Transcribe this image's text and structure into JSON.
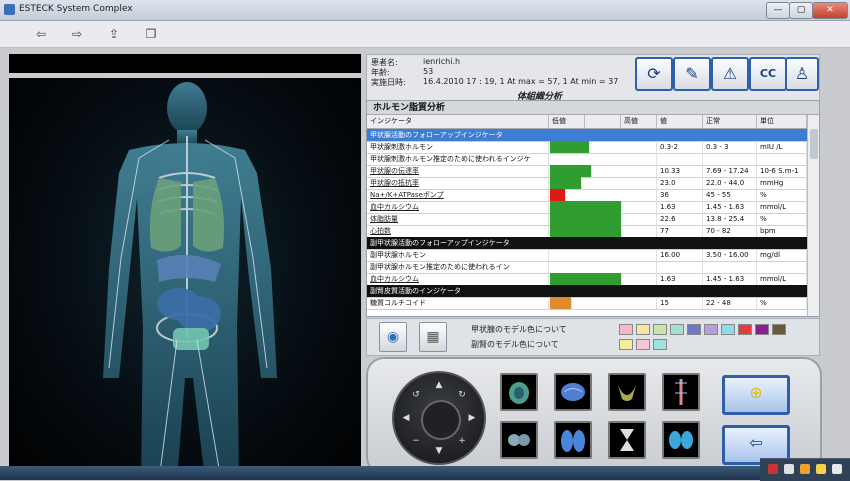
{
  "window": {
    "title": "ESTECK System Complex",
    "controls": {
      "minimize": "—",
      "maximize": "▢",
      "close": "✕"
    }
  },
  "toolbar": {
    "back": "⇦",
    "forward": "⇨",
    "export": "⇪",
    "copy": "❐"
  },
  "patient": {
    "name_label": "患者名:",
    "name_value": "ienrichi.h",
    "age_label": "年齢:",
    "age_value": "53",
    "date_label": "実施日時:",
    "date_value": "16.4.2010 17 : 19, 1 At max = 57, 1 At min = 37"
  },
  "panel_caption": "体組織分析",
  "section_title": "ホルモン脂質分析",
  "columns": [
    "インジケータ",
    "低値",
    "",
    "高値",
    "値",
    "正常",
    "単位"
  ],
  "rows": [
    {
      "type": "group",
      "selected": true,
      "name": "甲状腺活動のフォローアップインジケータ"
    },
    {
      "type": "item",
      "name": "甲状腺刺激ホルモン",
      "value": "0.3-2",
      "normal": "0.3 - 3",
      "unit": "mIU /L",
      "bar_level": 0.55,
      "bar_color": "#2f9d2f"
    },
    {
      "type": "item",
      "name": "甲状腺刺激ホルモン推定のために使われるインジケ",
      "value": "",
      "normal": "",
      "unit": "",
      "bar_level": 0,
      "bar_color": "#2f9d2f"
    },
    {
      "type": "sub",
      "name": "甲状腺の伝達率",
      "value": "10.33",
      "normal": "7.69 - 17.24",
      "unit": "10-6 S.m-1",
      "bar_level": 0.58,
      "bar_color": "#2f9d2f"
    },
    {
      "type": "sub",
      "name": "甲状腺の抵抗率",
      "value": "23.0",
      "normal": "22.0 - 44.0",
      "unit": "mmHg",
      "bar_level": 0.45,
      "bar_color": "#2f9d2f"
    },
    {
      "type": "sub",
      "name": "Na+/K+ATPaseポンプ",
      "value": "36",
      "normal": "45 - 55",
      "unit": "%",
      "bar_level": 0.22,
      "bar_color": "#e01818"
    },
    {
      "type": "sub",
      "name": "血中カルシウム",
      "value": "1.63",
      "normal": "1.45 - 1.63",
      "unit": "mmol/L",
      "bar_level": 1.0,
      "bar_color": "#2f9d2f"
    },
    {
      "type": "sub",
      "name": "体脂肪量",
      "value": "22.6",
      "normal": "13.8 - 25.4",
      "unit": "%",
      "bar_level": 1.0,
      "bar_color": "#2f9d2f"
    },
    {
      "type": "sub",
      "name": "心拍数",
      "value": "77",
      "normal": "70 - 82",
      "unit": "bpm",
      "bar_level": 1.0,
      "bar_color": "#2f9d2f"
    },
    {
      "type": "group",
      "selected": false,
      "name": "副甲状腺活動のフォローアップインジケータ"
    },
    {
      "type": "item",
      "name": "副甲状腺ホルモン",
      "value": "16.00",
      "normal": "3.50 - 16.00",
      "unit": "mg/dl",
      "bar_level": 0,
      "bar_color": "#2f9d2f"
    },
    {
      "type": "item",
      "name": "副甲状腺ホルモン推定のために使われるイン",
      "value": "",
      "normal": "",
      "unit": "",
      "bar_level": 0,
      "bar_color": "#2f9d2f"
    },
    {
      "type": "sub",
      "name": "血中カルシウム",
      "value": "1.63",
      "normal": "1.45 - 1.63",
      "unit": "mmol/L",
      "bar_level": 1.0,
      "bar_color": "#2f9d2f"
    },
    {
      "type": "group",
      "selected": false,
      "name": "副腎皮質活動のインジケータ"
    },
    {
      "type": "item",
      "name": "糖質コルチコイド",
      "value": "15",
      "normal": "22 - 48",
      "unit": "%",
      "bar_level": 0.3,
      "bar_color": "#e08a30"
    }
  ],
  "legend": {
    "line1": "甲状腺のモデル色について",
    "line2": "副腎のモデル色について",
    "colors1": [
      "#f6b6c8",
      "#f4e8a0",
      "#c9e4a8",
      "#a8dfd0",
      "#6b79c6",
      "#b79de0",
      "#8fd8e8",
      "#e03c3c",
      "#8c1d8c",
      "#6b5a3a"
    ],
    "colors2": [
      "#f4ec9a",
      "#f4c6d6",
      "#9fe3e0"
    ]
  },
  "icons": {
    "top": [
      "refresh-icon",
      "tool-icon",
      "warning-icon",
      "cc-icon",
      "tube-icon"
    ],
    "top_glyphs": [
      "⟳",
      "✎",
      "⚠",
      "CC",
      "♙"
    ],
    "legend_btn1": "◉",
    "legend_btn2": "▦",
    "big_btn1": "⊕",
    "big_btn2": "⇦"
  }
}
